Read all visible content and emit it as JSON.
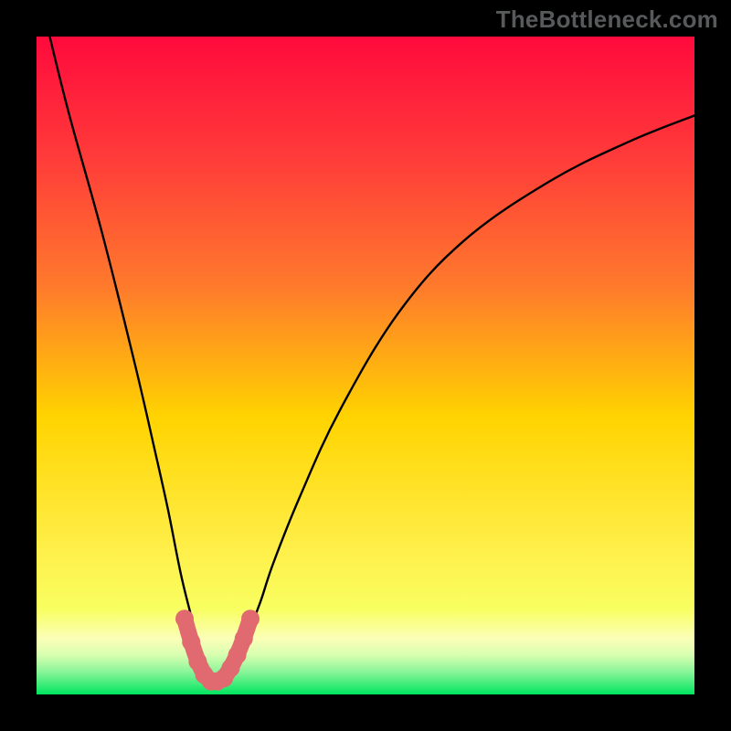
{
  "watermark": {
    "text": "TheBottleneck.com"
  },
  "chart_data": {
    "type": "line",
    "title": "",
    "xlabel": "",
    "ylabel": "",
    "xlim": [
      0,
      100
    ],
    "ylim": [
      0,
      100
    ],
    "gradient_colors": {
      "top": "#ff0a3c",
      "upper_mid": "#ff7a2c",
      "mid": "#ffd400",
      "lower_mid": "#f8ff60",
      "pale_band": "#fbffb8",
      "bottom": "#00e560"
    },
    "series": [
      {
        "name": "curve",
        "color": "#000000",
        "x": [
          2,
          5,
          10,
          15,
          18,
          20,
          22,
          24,
          25,
          26,
          27,
          28,
          29,
          30,
          32,
          34,
          36,
          40,
          46,
          55,
          65,
          78,
          90,
          100
        ],
        "values": [
          100,
          88,
          70,
          50,
          37,
          28,
          18,
          10,
          6,
          3,
          2,
          2,
          3,
          5,
          9,
          14,
          20,
          30,
          43,
          58,
          69,
          78,
          84,
          88
        ]
      },
      {
        "name": "highlight-band",
        "color": "#e06a6f",
        "x": [
          22.5,
          23.5,
          24.5,
          25.5,
          26.5,
          27.5,
          28.5,
          29.5,
          30.5,
          31.5,
          32.5
        ],
        "values": [
          11.5,
          8.0,
          5.0,
          3.0,
          2.0,
          2.0,
          2.5,
          4.0,
          6.0,
          8.5,
          11.5
        ]
      }
    ]
  }
}
